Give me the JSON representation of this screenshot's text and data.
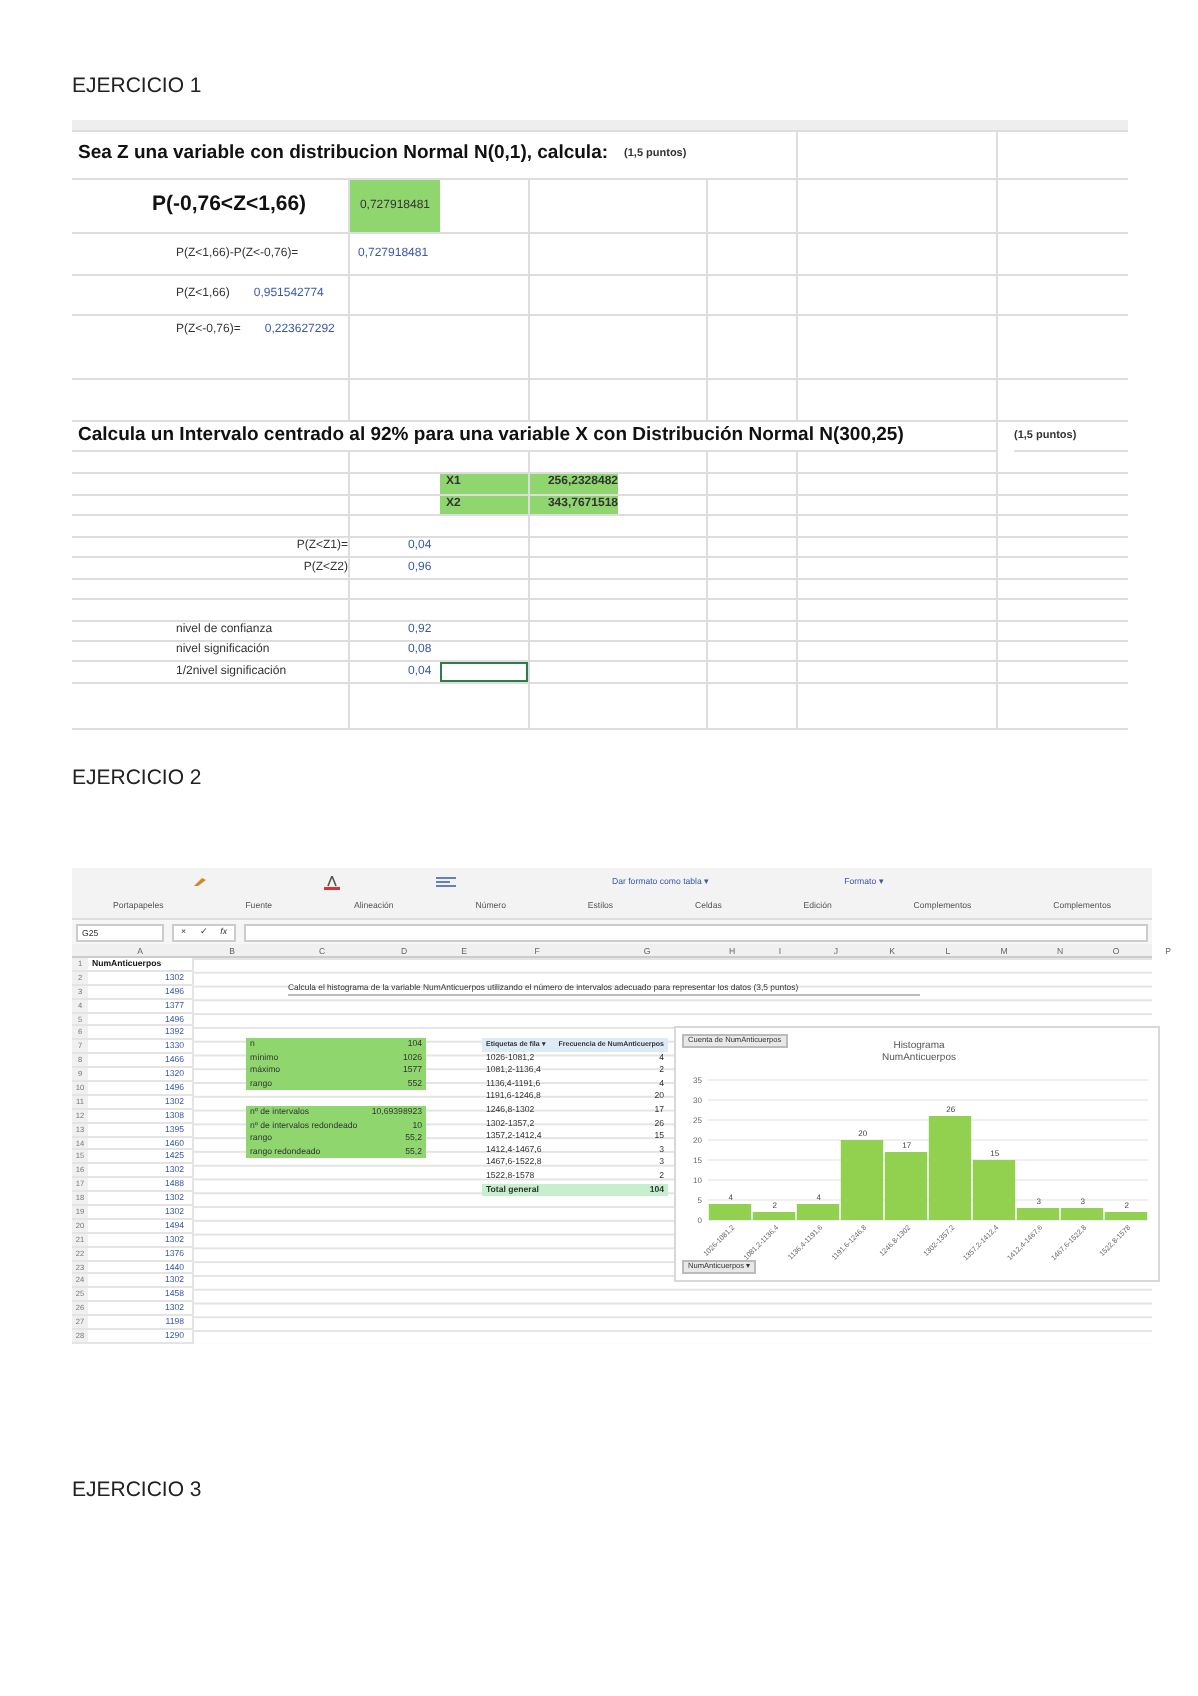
{
  "exercises": [
    {
      "heading": "EJERCICIO 1",
      "kind": "normal_sheet",
      "sheet": {
        "title": "Sea Z una variable con distribucion Normal N(0,1), calcula:",
        "points": "(1,5 puntos)",
        "probability": {
          "label": "P(-0,76<Z<1,66)",
          "value": "0,727918481"
        },
        "difference": {
          "label": "P(Z<1,66)-P(Z<-0,76)=",
          "value": "0,727918481"
        },
        "p_upper": {
          "label": "P(Z<1,66)",
          "value": "0,951542774"
        },
        "p_lower": {
          "label": "P(Z<-0,76)=",
          "value": "0,223627292"
        },
        "title2": "Calcula un Intervalo centrado al 92%  para una variable X con Distribución Normal N(300,25)",
        "points2": "(1,5 puntos)",
        "x1": {
          "label": "X1",
          "value": "256,2328482"
        },
        "x2": {
          "label": "X2",
          "value": "343,7671518"
        },
        "p_z1": {
          "label": "P(Z<Z1)=",
          "value": "0,04"
        },
        "p_z2": {
          "label": "P(Z<Z2)",
          "value": "0,96"
        },
        "confidence": {
          "label": "nivel de confianza",
          "value": "0,92"
        },
        "significance": {
          "label": "nivel significación",
          "value": "0,08"
        },
        "half_significance": {
          "label": "1/2nivel significación",
          "value": "0,04"
        }
      }
    },
    {
      "heading": "EJERCICIO 2",
      "kind": "histogram_sheet",
      "sheet": {
        "ribbon_top": [
          "Dar formato como tabla ▾",
          "Formato ▾"
        ],
        "ribbon_groups": [
          "Portapapeles",
          "Fuente",
          "Alineación",
          "Número",
          "Estilos",
          "Celdas",
          "Edición",
          "Complementos",
          "Complementos"
        ],
        "name_box": "G25",
        "formula_buttons": [
          "×",
          "✓",
          "fx"
        ],
        "row_numbers": [
          "1",
          "2",
          "3",
          "4",
          "5",
          "6",
          "7",
          "8",
          "9",
          "10",
          "11",
          "12",
          "13",
          "14",
          "15",
          "16",
          "17",
          "18",
          "19",
          "20",
          "21",
          "22",
          "23",
          "24",
          "25",
          "26",
          "27",
          "28"
        ],
        "columns": [
          "A",
          "B",
          "C",
          "D",
          "E",
          "F",
          "G",
          "H",
          "I",
          "J",
          "K",
          "L",
          "M",
          "N",
          "O",
          "P"
        ],
        "column_a": [
          "NumAnticuerpos",
          "1302",
          "1496",
          "1377",
          "1496",
          "1392",
          "1330",
          "1466",
          "1320",
          "1496",
          "1302",
          "1308",
          "1395",
          "1460",
          "1425",
          "1302",
          "1488",
          "1302",
          "1302",
          "1494",
          "1302",
          "1376",
          "1440",
          "1302",
          "1458",
          "1302",
          "1198",
          "1290"
        ],
        "instruction": "Calcula el histograma de la variable NumAnticuerpos utilizando el número de intervalos adecuado para representar los datos (3,5 puntos)",
        "stats": [
          {
            "label": "n",
            "value": "104"
          },
          {
            "label": "mínimo",
            "value": "1026"
          },
          {
            "label": "máximo",
            "value": "1577"
          },
          {
            "label": "rango",
            "value": "552"
          }
        ],
        "stats2": [
          {
            "label": "nº de intervalos",
            "value": "10,69398923"
          },
          {
            "label": "nº de intervalos redondeado",
            "value": "10"
          },
          {
            "label": "rango",
            "value": "55,2"
          },
          {
            "label": "rango redondeado",
            "value": "55,2"
          }
        ],
        "pivot": {
          "header": [
            "Etiquetas de fila ▾",
            "Frecuencia de NumAnticuerpos"
          ],
          "rows": [
            [
              "1026-1081,2",
              "4"
            ],
            [
              "1081,2-1136,4",
              "2"
            ],
            [
              "1136,4-1191,6",
              "4"
            ],
            [
              "1191,6-1246,8",
              "20"
            ],
            [
              "1246,8-1302",
              "17"
            ],
            [
              "1302-1357,2",
              "26"
            ],
            [
              "1357,2-1412,4",
              "15"
            ],
            [
              "1412,4-1467,6",
              "3"
            ],
            [
              "1467,6-1522,8",
              "3"
            ],
            [
              "1522,8-1578",
              "2"
            ]
          ],
          "total": [
            "Total general",
            "104"
          ]
        },
        "chart_button": "Cuenta de NumAnticuerpos",
        "axis_button": "NumAnticuerpos ▾",
        "chart_data": {
          "type": "bar",
          "title": "Histograma NumAnticuerpos",
          "categories": [
            "1026-1081,2",
            "1081,2-1136,4",
            "1136,4-1191,6",
            "1191,6-1246,8",
            "1246,8-1302",
            "1302-1357,2",
            "1357,2-1412,4",
            "1412,4-1467,6",
            "1467,6-1522,8",
            "1522,8-1578"
          ],
          "series": [
            {
              "color": "#92d050",
              "values": [
                4,
                2,
                4,
                20,
                17,
                26,
                15,
                3,
                3,
                2
              ]
            }
          ],
          "ylim": [
            0,
            35
          ],
          "yticks": [
            0,
            5,
            10,
            15,
            20,
            25,
            30,
            35
          ],
          "grid": true,
          "data_labels": true
        }
      }
    },
    {
      "heading": "EJERCICIO 3",
      "kind": "empty"
    }
  ]
}
